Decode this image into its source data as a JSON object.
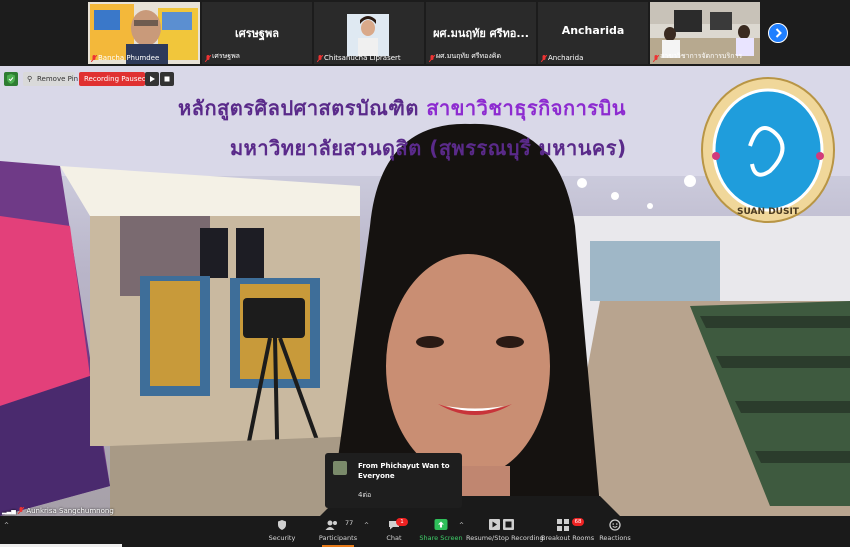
{
  "participants": [
    {
      "display_name": "Bancha Phumdee",
      "type": "video"
    },
    {
      "display_name": "เศรษฐพล",
      "label": "เศรษฐพล",
      "type": "name"
    },
    {
      "display_name": "Chitsanucha Liprasert",
      "type": "video"
    },
    {
      "display_name": "ผศ.มนฤทัย ศรีทองคิด",
      "label": "ผศ.มนฤทัย ศรีทอ...",
      "type": "name"
    },
    {
      "display_name": "Ancharida",
      "label": "Ancharida",
      "type": "name"
    },
    {
      "display_name": "สาขาวิชาการจัดการบริการ",
      "type": "video"
    }
  ],
  "video_toolbar": {
    "remove_pin": "Remove Pin",
    "recording_status": "Recording Paused"
  },
  "slide": {
    "line1_a": "หลักสูตรศิลปศาสตรบัณฑิต ",
    "line1_b": "สาขาวิชาธุรกิจการบิน",
    "line2": "มหาวิทยาลัยสวนดุสิต (สุพรรณบุรี มหานคร)",
    "logo_text": "SUAN DUSIT UNIVERSITY"
  },
  "speaker_name": "Aunkrisa Sangchumnong",
  "chat_popup": {
    "from": "From Phichayut Wan to Everyone",
    "message": "4ต่อ"
  },
  "toolbar": {
    "security": "Security",
    "participants": "Participants",
    "participants_count": "77",
    "chat": "Chat",
    "chat_badge": "1",
    "share_screen": "Share Screen",
    "recording": "Resume/Stop Recording",
    "breakout": "Breakout Rooms",
    "breakout_badge": "68",
    "reactions": "Reactions"
  },
  "colors": {
    "accent_blue": "#1f7fff",
    "recording_red": "#e03131",
    "share_green": "#3fd06a",
    "slide_purple": "#5a2a8a"
  }
}
